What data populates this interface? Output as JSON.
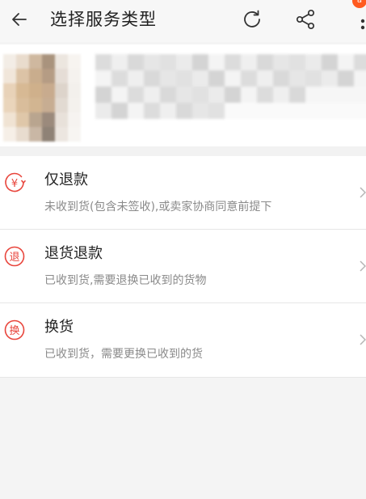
{
  "header": {
    "title": "选择服务类型",
    "back_icon": "arrow-left-icon",
    "refresh_icon": "refresh-icon",
    "share_icon": "share-icon",
    "more_icon": "more-vertical-icon",
    "badge_color": "#ff5a1f"
  },
  "product": {
    "note": ""
  },
  "options": [
    {
      "title": "仅退款",
      "description": "未收到货(包含未签收),或卖家协商同意前提下",
      "icon_char": "¥",
      "icon": "refund-yuan-icon"
    },
    {
      "title": "退货退款",
      "description": "已收到货,需要退换已收到的货物",
      "icon_char": "退",
      "icon": "return-icon"
    },
    {
      "title": "换货",
      "description": "已收到货，需要更换已收到的货",
      "icon_char": "换",
      "icon": "exchange-icon"
    }
  ],
  "colors": {
    "accent": "#e8453c",
    "title_text": "#222222",
    "desc_text": "#8a8a8a",
    "background": "#f4f4f4"
  }
}
